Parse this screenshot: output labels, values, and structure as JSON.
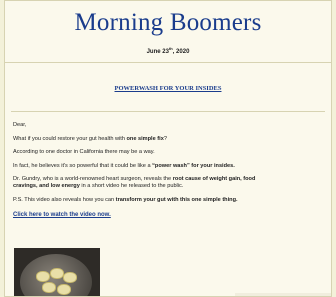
{
  "newsletter": {
    "title": "Morning Boomers",
    "date_main": "June 23",
    "date_sup": "th",
    "date_year": ", 2020"
  },
  "headline": "POWERWASH FOR YOUR INSIDES",
  "body": {
    "greeting": "Dear,",
    "p1_pre": "What if you could restore your gut health with ",
    "p1_bold": "one simple fix",
    "p1_post": "?",
    "p2": "According to one doctor in California there may be a way.",
    "p3_pre": "In fact, he believes it's so powerful that it could be like a ",
    "p3_bold": "“power wash” for your insides.",
    "p4_pre": "Dr. Gundry, who is a world-renowned heart surgeon, reveals the ",
    "p4_bold1": "root cause of weight gain, food",
    "p4_bold2": "cravings, and low energy",
    "p4_post": " in a short video he released to the public.",
    "p5_pre": "P.S. This video also reveals how you can ",
    "p5_bold": "transform your gut with this one simple thing.",
    "cta": "Click here to watch the video now."
  },
  "image": {
    "alt_icon": "banana-pot-photo"
  }
}
